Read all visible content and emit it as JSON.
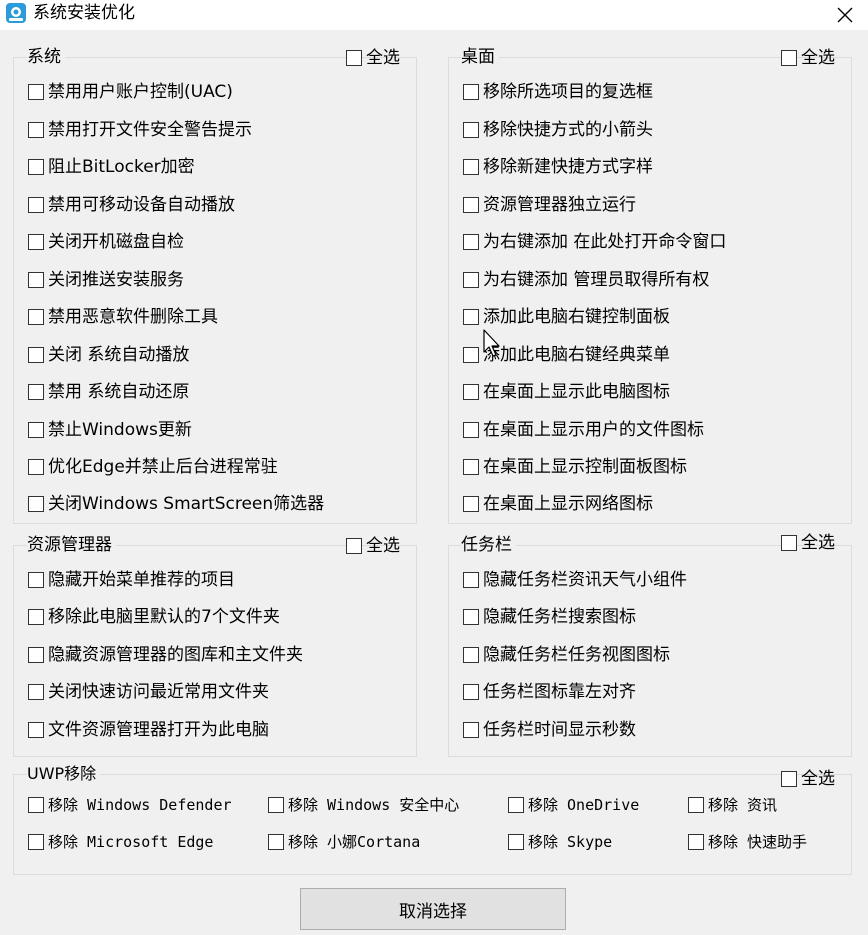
{
  "window": {
    "title": "系统安装优化"
  },
  "select_all_label": "全选",
  "groups": {
    "system": {
      "title": "系统",
      "items": [
        "禁用用户账户控制(UAC)",
        "禁用打开文件安全警告提示",
        "阻止BitLocker加密",
        "禁用可移动设备自动播放",
        "关闭开机磁盘自检",
        "关闭推送安装服务",
        "禁用恶意软件删除工具",
        "关闭 系统自动播放",
        "禁用 系统自动还原",
        "禁止Windows更新",
        "优化Edge并禁止后台进程常驻",
        "关闭Windows SmartScreen筛选器"
      ]
    },
    "desktop": {
      "title": "桌面",
      "items": [
        "移除所选项目的复选框",
        "移除快捷方式的小箭头",
        "移除新建快捷方式字样",
        "资源管理器独立运行",
        "为右键添加 在此处打开命令窗口",
        "为右键添加 管理员取得所有权",
        "添加此电脑右键控制面板",
        "添加此电脑右键经典菜单",
        "在桌面上显示此电脑图标",
        "在桌面上显示用户的文件图标",
        "在桌面上显示控制面板图标",
        "在桌面上显示网络图标"
      ]
    },
    "explorer": {
      "title": "资源管理器",
      "items": [
        "隐藏开始菜单推荐的项目",
        "移除此电脑里默认的7个文件夹",
        "隐藏资源管理器的图库和主文件夹",
        "关闭快速访问最近常用文件夹",
        "文件资源管理器打开为此电脑"
      ]
    },
    "taskbar": {
      "title": "任务栏",
      "items": [
        "隐藏任务栏资讯天气小组件",
        "隐藏任务栏搜索图标",
        "隐藏任务栏任务视图图标",
        "任务栏图标靠左对齐",
        "任务栏时间显示秒数"
      ]
    },
    "uwp": {
      "title": "UWP移除",
      "items": [
        "移除 Windows Defender",
        "移除 Windows 安全中心",
        "移除 OneDrive",
        "移除 资讯",
        "移除 Microsoft Edge",
        "移除 小娜Cortana",
        "移除 Skype",
        "移除 快速助手"
      ]
    }
  },
  "cancel_button": "取消选择",
  "icons": {
    "app": "app-icon",
    "close": "close-icon",
    "cursor": "mouse-cursor"
  }
}
